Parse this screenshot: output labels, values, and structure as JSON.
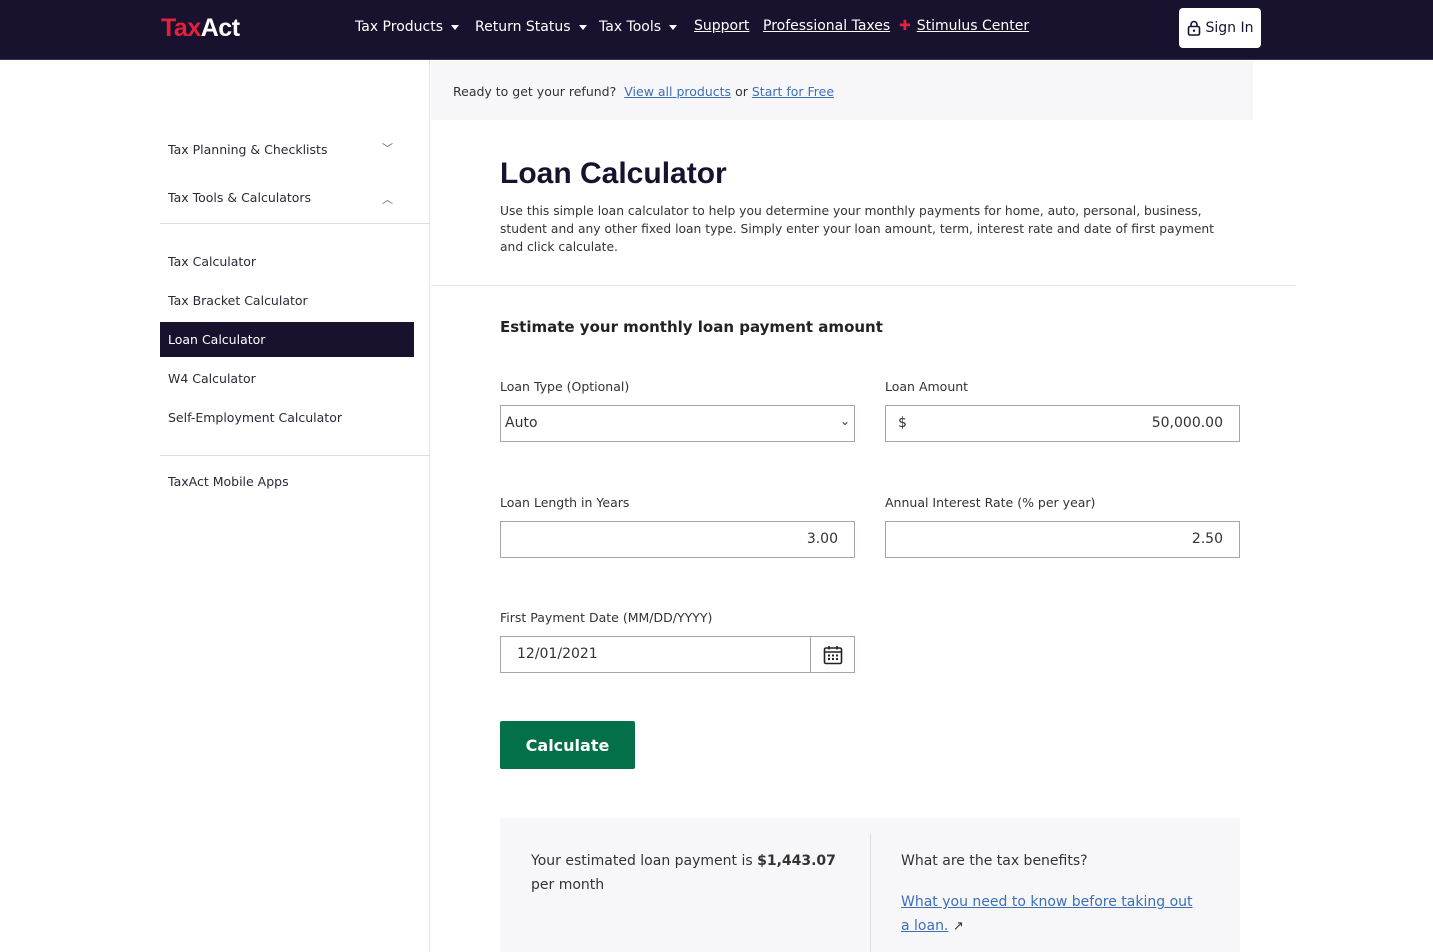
{
  "header": {
    "logo_red": "Tax",
    "logo_white": "Act",
    "nav": [
      {
        "label": "Tax Products"
      },
      {
        "label": "Return Status"
      },
      {
        "label": "Tax Tools"
      },
      {
        "label": "Support"
      },
      {
        "label": "Professional Taxes"
      },
      {
        "label": "Stimulus Center"
      }
    ],
    "sign_in": "Sign In"
  },
  "sidebar": {
    "sections": [
      {
        "label": "Tax Planning & Checklists"
      },
      {
        "label": "Tax Tools & Calculators"
      }
    ],
    "items": [
      {
        "label": "Tax Calculator"
      },
      {
        "label": "Tax Bracket Calculator"
      },
      {
        "label": "Loan Calculator",
        "active": true
      },
      {
        "label": "W4 Calculator"
      },
      {
        "label": "Self-Employment Calculator"
      }
    ],
    "footer_item": "TaxAct Mobile Apps"
  },
  "banner": {
    "text": "Ready to get your refund?",
    "link1": "View all products",
    "or": "or",
    "link2": "Start for Free"
  },
  "page": {
    "title": "Loan Calculator",
    "description": "Use this simple loan calculator to help you determine your monthly payments for home, auto, personal, business, student and any other fixed loan type. Simply enter your loan amount, term, interest rate and date of first payment and click calculate."
  },
  "form": {
    "heading": "Estimate your monthly loan payment amount",
    "loan_type": {
      "label": "Loan Type (Optional)",
      "value": "Auto"
    },
    "loan_amount": {
      "label": "Loan Amount",
      "prefix": "$",
      "value": "50,000.00"
    },
    "loan_length": {
      "label": "Loan Length in Years",
      "value": "3.00"
    },
    "interest": {
      "label": "Annual Interest Rate (% per year)",
      "value": "2.50"
    },
    "first_payment": {
      "label": "First Payment Date (MM/DD/YYYY)",
      "value": "12/01/2021"
    },
    "calculate": "Calculate"
  },
  "result": {
    "prefix": "Your estimated loan payment is",
    "amount": "$1,443.07",
    "suffix": "per month",
    "benefits_q": "What are the tax benefits?",
    "benefits_link": "What you need to know before taking out a loan."
  },
  "colors": {
    "nav_bg": "#19122f",
    "brand_red": "#e4203a",
    "button_green": "#03704a",
    "link": "#3d6fb6"
  }
}
